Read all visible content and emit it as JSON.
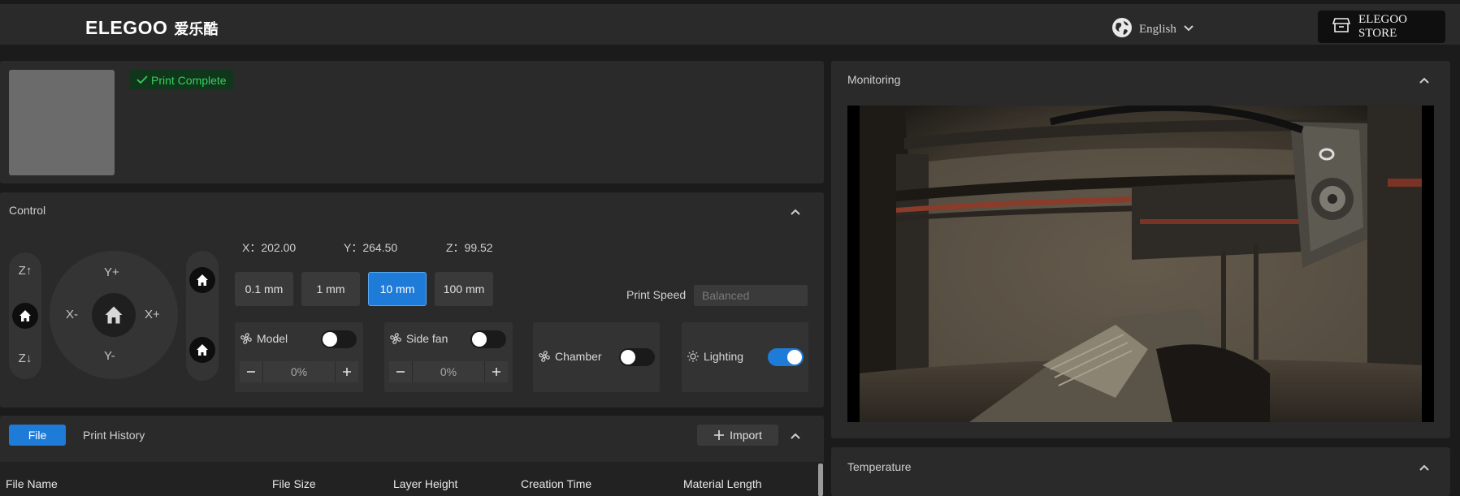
{
  "header": {
    "logo_text": "ELEGOO",
    "logo_cn": "爱乐酷",
    "language": "English",
    "store_label": "ELEGOO STORE"
  },
  "status": {
    "badge": "Print Complete",
    "badge_color": "#36d15a"
  },
  "control": {
    "title": "Control",
    "z_up": "Z↑",
    "z_down": "Z↓",
    "y_plus": "Y+",
    "y_minus": "Y-",
    "x_minus": "X-",
    "x_plus": "X+",
    "coords": {
      "x": "X：202.00",
      "y": "Y：264.50",
      "z": "Z：99.52"
    },
    "steps": [
      "0.1 mm",
      "1 mm",
      "10 mm",
      "100 mm"
    ],
    "active_step": "10 mm",
    "print_speed_label": "Print Speed",
    "print_speed_value": "Balanced",
    "model_fan": {
      "label": "Model",
      "value": "0%",
      "on": false
    },
    "side_fan": {
      "label": "Side fan",
      "value": "0%",
      "on": false
    },
    "chamber": {
      "label": "Chamber",
      "on": false
    },
    "lighting": {
      "label": "Lighting",
      "on": true
    },
    "accent": "#1e7bd8"
  },
  "files": {
    "tab_file": "File",
    "tab_history": "Print History",
    "import_label": "Import",
    "columns": [
      "File Name",
      "File Size",
      "Layer Height",
      "Creation Time",
      "Material Length"
    ]
  },
  "monitoring": {
    "title": "Monitoring"
  },
  "temperature": {
    "title": "Temperature"
  }
}
